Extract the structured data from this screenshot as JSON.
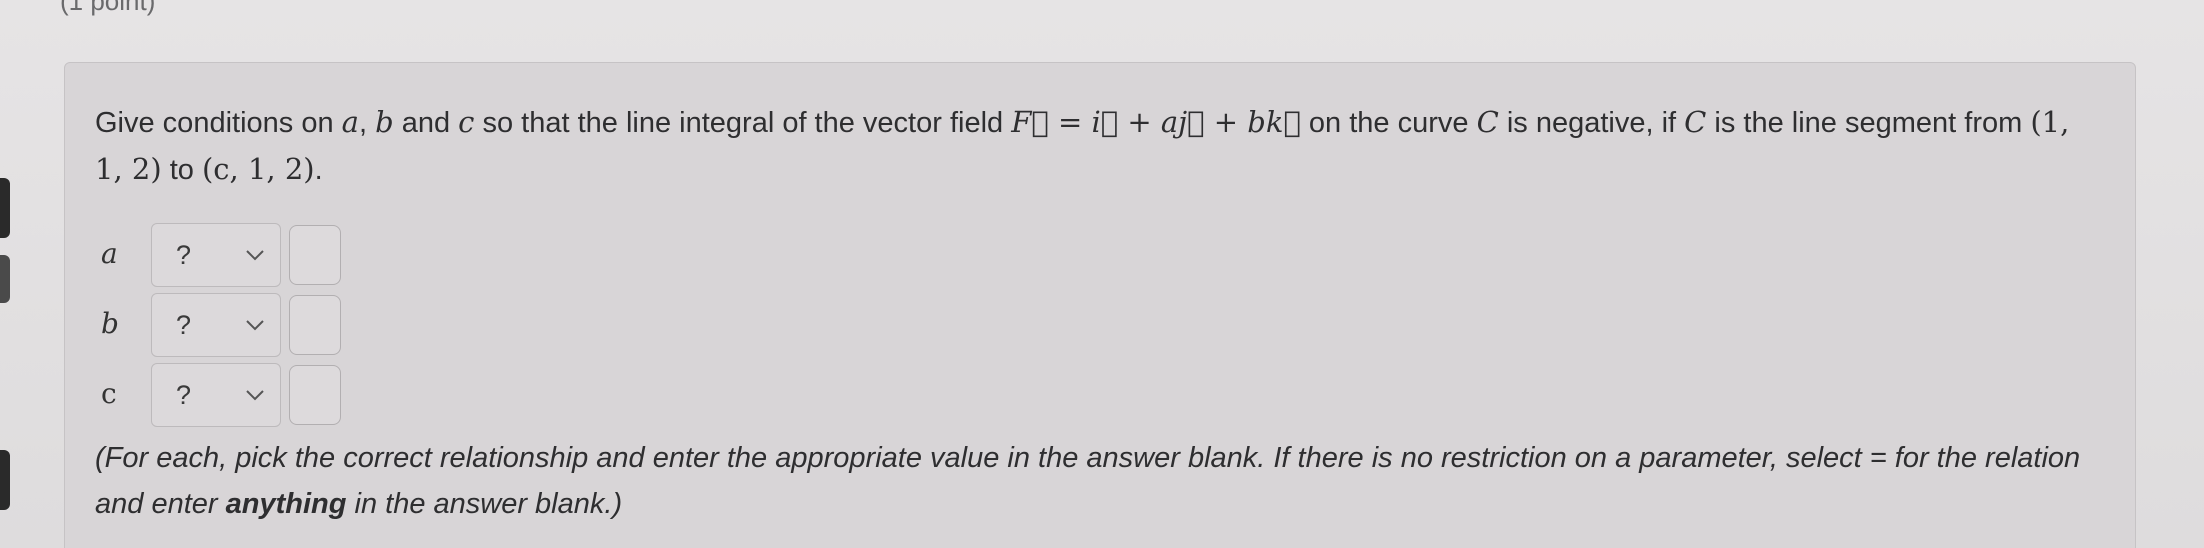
{
  "header_fragment": "(1 point)",
  "question": {
    "part1": "Give conditions on ",
    "var_a": "a",
    "comma": ", ",
    "var_b": "b",
    "and": " and ",
    "var_c": "c",
    "part2": " so that the line integral of the vector field ",
    "field_expr": "F⃗ = i⃗ + aj⃗ + bk⃗",
    "part3": " on the curve ",
    "curve": "C",
    "part4": " is negative, if ",
    "curve2": "C",
    "part5": " is the line segment from ",
    "point1": "(1, 1, 2)",
    "to": " to ",
    "point2": "(c, 1, 2)",
    "end": "."
  },
  "rows": [
    {
      "var": "a",
      "select_value": "?",
      "answer_value": ""
    },
    {
      "var": "b",
      "select_value": "?",
      "answer_value": ""
    },
    {
      "var": "c",
      "select_value": "?",
      "answer_value": ""
    }
  ],
  "instructions": {
    "part1": "(For each, pick the correct relationship and enter the appropriate value in the answer blank. If there is no restriction on a parameter, select = for the relation and enter ",
    "bold": "anything",
    "part2": " in the answer blank.)"
  },
  "icons": {
    "dropdown": "chevron-down-icon"
  }
}
